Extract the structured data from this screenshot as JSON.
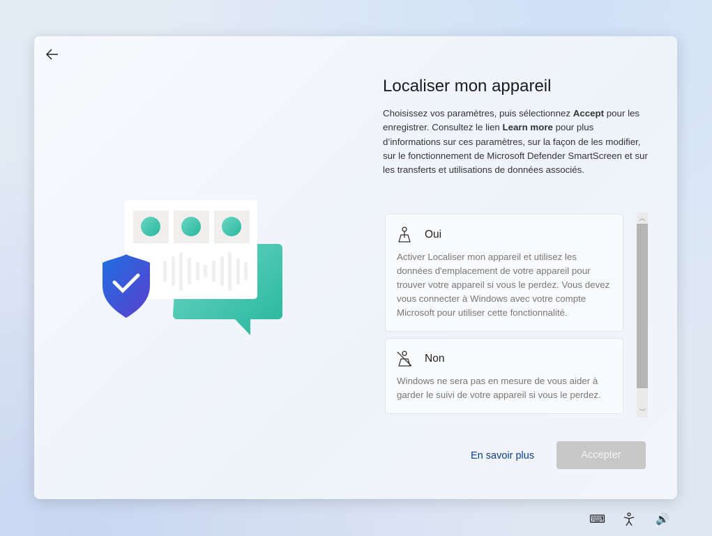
{
  "title": "Localiser mon appareil",
  "description": {
    "p1": "Choisissez vos paramètres, puis sélectionnez ",
    "accept_bold": "Accept",
    "p2": " pour les enregistrer. Consultez le lien ",
    "learn_bold": "Learn more",
    "p3": " pour plus d’informations sur ces paramètres, sur la façon de les modifier, sur le fonctionnement de Microsoft Defender SmartScreen et sur les transferts et utilisations de données associés."
  },
  "options": [
    {
      "label": "Oui",
      "icon": "location-person-icon",
      "text": "Activer Localiser mon appareil et utilisez les données d'emplacement de votre appareil pour trouver votre appareil si vous le perdez. Vous devez vous connecter à Windows avec votre compte Microsoft pour utiliser cette fonctionnalité."
    },
    {
      "label": "Non",
      "icon": "location-off-icon",
      "text": "Windows ne sera pas en mesure de vous aider à garder le suivi de votre appareil si vous le perdez."
    }
  ],
  "learn_more": "En savoir plus",
  "accept": "Accepter",
  "tray": {
    "keyboard": "⌨",
    "accessibility": "accessibility-icon",
    "volume": "🔊"
  }
}
